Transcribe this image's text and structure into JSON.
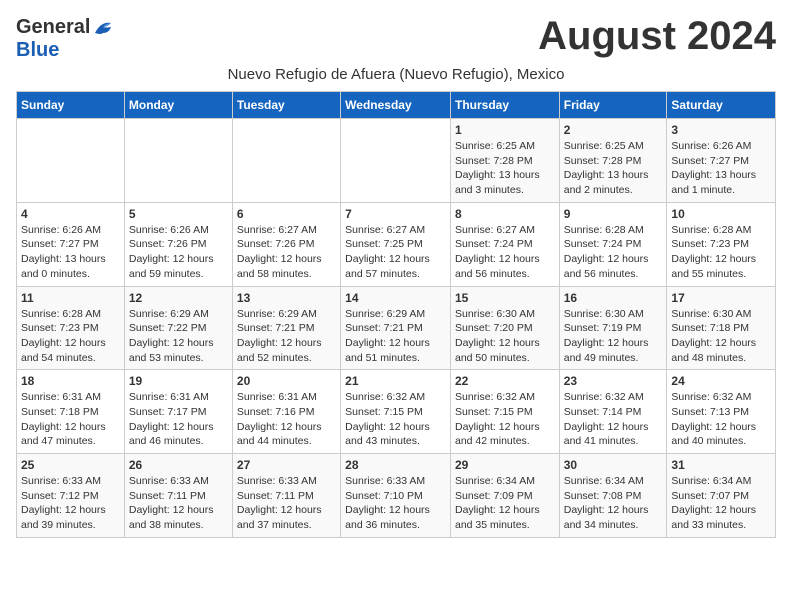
{
  "header": {
    "logo_general": "General",
    "logo_blue": "Blue",
    "month_title": "August 2024",
    "subtitle": "Nuevo Refugio de Afuera (Nuevo Refugio), Mexico"
  },
  "days_of_week": [
    "Sunday",
    "Monday",
    "Tuesday",
    "Wednesday",
    "Thursday",
    "Friday",
    "Saturday"
  ],
  "weeks": [
    [
      {
        "day": "",
        "info": ""
      },
      {
        "day": "",
        "info": ""
      },
      {
        "day": "",
        "info": ""
      },
      {
        "day": "",
        "info": ""
      },
      {
        "day": "1",
        "info": "Sunrise: 6:25 AM\nSunset: 7:28 PM\nDaylight: 13 hours\nand 3 minutes."
      },
      {
        "day": "2",
        "info": "Sunrise: 6:25 AM\nSunset: 7:28 PM\nDaylight: 13 hours\nand 2 minutes."
      },
      {
        "day": "3",
        "info": "Sunrise: 6:26 AM\nSunset: 7:27 PM\nDaylight: 13 hours\nand 1 minute."
      }
    ],
    [
      {
        "day": "4",
        "info": "Sunrise: 6:26 AM\nSunset: 7:27 PM\nDaylight: 13 hours\nand 0 minutes."
      },
      {
        "day": "5",
        "info": "Sunrise: 6:26 AM\nSunset: 7:26 PM\nDaylight: 12 hours\nand 59 minutes."
      },
      {
        "day": "6",
        "info": "Sunrise: 6:27 AM\nSunset: 7:26 PM\nDaylight: 12 hours\nand 58 minutes."
      },
      {
        "day": "7",
        "info": "Sunrise: 6:27 AM\nSunset: 7:25 PM\nDaylight: 12 hours\nand 57 minutes."
      },
      {
        "day": "8",
        "info": "Sunrise: 6:27 AM\nSunset: 7:24 PM\nDaylight: 12 hours\nand 56 minutes."
      },
      {
        "day": "9",
        "info": "Sunrise: 6:28 AM\nSunset: 7:24 PM\nDaylight: 12 hours\nand 56 minutes."
      },
      {
        "day": "10",
        "info": "Sunrise: 6:28 AM\nSunset: 7:23 PM\nDaylight: 12 hours\nand 55 minutes."
      }
    ],
    [
      {
        "day": "11",
        "info": "Sunrise: 6:28 AM\nSunset: 7:23 PM\nDaylight: 12 hours\nand 54 minutes."
      },
      {
        "day": "12",
        "info": "Sunrise: 6:29 AM\nSunset: 7:22 PM\nDaylight: 12 hours\nand 53 minutes."
      },
      {
        "day": "13",
        "info": "Sunrise: 6:29 AM\nSunset: 7:21 PM\nDaylight: 12 hours\nand 52 minutes."
      },
      {
        "day": "14",
        "info": "Sunrise: 6:29 AM\nSunset: 7:21 PM\nDaylight: 12 hours\nand 51 minutes."
      },
      {
        "day": "15",
        "info": "Sunrise: 6:30 AM\nSunset: 7:20 PM\nDaylight: 12 hours\nand 50 minutes."
      },
      {
        "day": "16",
        "info": "Sunrise: 6:30 AM\nSunset: 7:19 PM\nDaylight: 12 hours\nand 49 minutes."
      },
      {
        "day": "17",
        "info": "Sunrise: 6:30 AM\nSunset: 7:18 PM\nDaylight: 12 hours\nand 48 minutes."
      }
    ],
    [
      {
        "day": "18",
        "info": "Sunrise: 6:31 AM\nSunset: 7:18 PM\nDaylight: 12 hours\nand 47 minutes."
      },
      {
        "day": "19",
        "info": "Sunrise: 6:31 AM\nSunset: 7:17 PM\nDaylight: 12 hours\nand 46 minutes."
      },
      {
        "day": "20",
        "info": "Sunrise: 6:31 AM\nSunset: 7:16 PM\nDaylight: 12 hours\nand 44 minutes."
      },
      {
        "day": "21",
        "info": "Sunrise: 6:32 AM\nSunset: 7:15 PM\nDaylight: 12 hours\nand 43 minutes."
      },
      {
        "day": "22",
        "info": "Sunrise: 6:32 AM\nSunset: 7:15 PM\nDaylight: 12 hours\nand 42 minutes."
      },
      {
        "day": "23",
        "info": "Sunrise: 6:32 AM\nSunset: 7:14 PM\nDaylight: 12 hours\nand 41 minutes."
      },
      {
        "day": "24",
        "info": "Sunrise: 6:32 AM\nSunset: 7:13 PM\nDaylight: 12 hours\nand 40 minutes."
      }
    ],
    [
      {
        "day": "25",
        "info": "Sunrise: 6:33 AM\nSunset: 7:12 PM\nDaylight: 12 hours\nand 39 minutes."
      },
      {
        "day": "26",
        "info": "Sunrise: 6:33 AM\nSunset: 7:11 PM\nDaylight: 12 hours\nand 38 minutes."
      },
      {
        "day": "27",
        "info": "Sunrise: 6:33 AM\nSunset: 7:11 PM\nDaylight: 12 hours\nand 37 minutes."
      },
      {
        "day": "28",
        "info": "Sunrise: 6:33 AM\nSunset: 7:10 PM\nDaylight: 12 hours\nand 36 minutes."
      },
      {
        "day": "29",
        "info": "Sunrise: 6:34 AM\nSunset: 7:09 PM\nDaylight: 12 hours\nand 35 minutes."
      },
      {
        "day": "30",
        "info": "Sunrise: 6:34 AM\nSunset: 7:08 PM\nDaylight: 12 hours\nand 34 minutes."
      },
      {
        "day": "31",
        "info": "Sunrise: 6:34 AM\nSunset: 7:07 PM\nDaylight: 12 hours\nand 33 minutes."
      }
    ]
  ]
}
